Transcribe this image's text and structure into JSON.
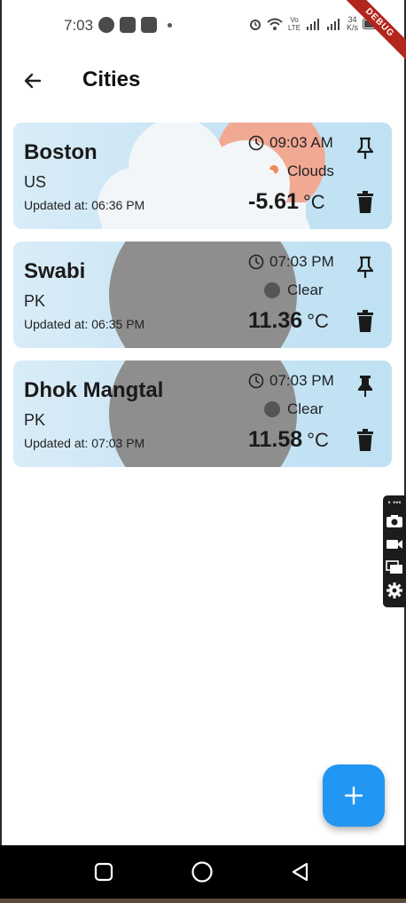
{
  "status_bar": {
    "time": "7:03",
    "net_speed_value": "34",
    "net_speed_unit": "K/s",
    "volte_label": "Vo LTE",
    "debug_label": "DEBUG"
  },
  "app_bar": {
    "title": "Cities"
  },
  "cities": [
    {
      "name": "Boston",
      "country": "US",
      "updated": "Updated at: 06:36 PM",
      "local_time": "09:03 AM",
      "condition": "Clouds",
      "temperature": "-5.61",
      "unit": "°C"
    },
    {
      "name": "Swabi",
      "country": "PK",
      "updated": "Updated at: 06:35 PM",
      "local_time": "07:03 PM",
      "condition": "Clear",
      "temperature": "11.36",
      "unit": "°C"
    },
    {
      "name": "Dhok Mangtal",
      "country": "PK",
      "updated": "Updated at: 07:03 PM",
      "local_time": "07:03 PM",
      "condition": "Clear",
      "temperature": "11.58",
      "unit": "°C"
    }
  ],
  "colors": {
    "fab": "#2196f3",
    "card_bg": "#c6e4f4",
    "sun": "#f4a58e",
    "moon": "#8e8e8e",
    "debug_banner": "#b3261e"
  },
  "icons": {
    "back": "arrow-left-icon",
    "clock": "clock-icon",
    "pin": "pin-icon",
    "delete": "trash-icon",
    "add": "plus-icon"
  }
}
